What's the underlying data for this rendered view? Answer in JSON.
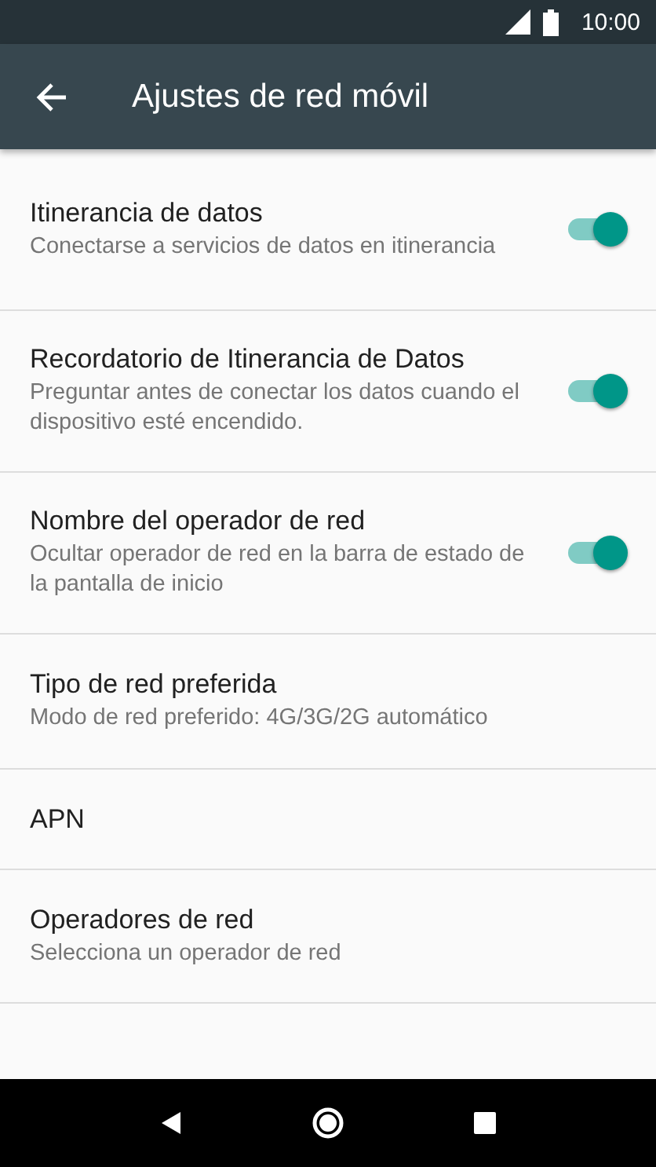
{
  "status_bar": {
    "time": "10:00"
  },
  "app_bar": {
    "title": "Ajustes de red móvil"
  },
  "settings": [
    {
      "kind": "switch",
      "title": "Itinerancia de datos",
      "summary": "Conectarse a servicios de datos en itinerancia",
      "on": true
    },
    {
      "kind": "switch",
      "title": "Recordatorio de Itinerancia de Datos",
      "summary": "Preguntar antes de conectar los datos cuando el dispositivo esté encendido.",
      "on": true
    },
    {
      "kind": "switch",
      "title": "Nombre del operador de red",
      "summary": "Ocultar operador de red en la barra de estado de la pantalla de inicio",
      "on": true
    },
    {
      "kind": "plain",
      "title": "Tipo de red preferida",
      "summary": "Modo de red preferido: 4G/3G/2G automático"
    },
    {
      "kind": "plain",
      "title": "APN"
    },
    {
      "kind": "plain",
      "title": "Operadores de red",
      "summary": "Selecciona un operador de red"
    }
  ]
}
